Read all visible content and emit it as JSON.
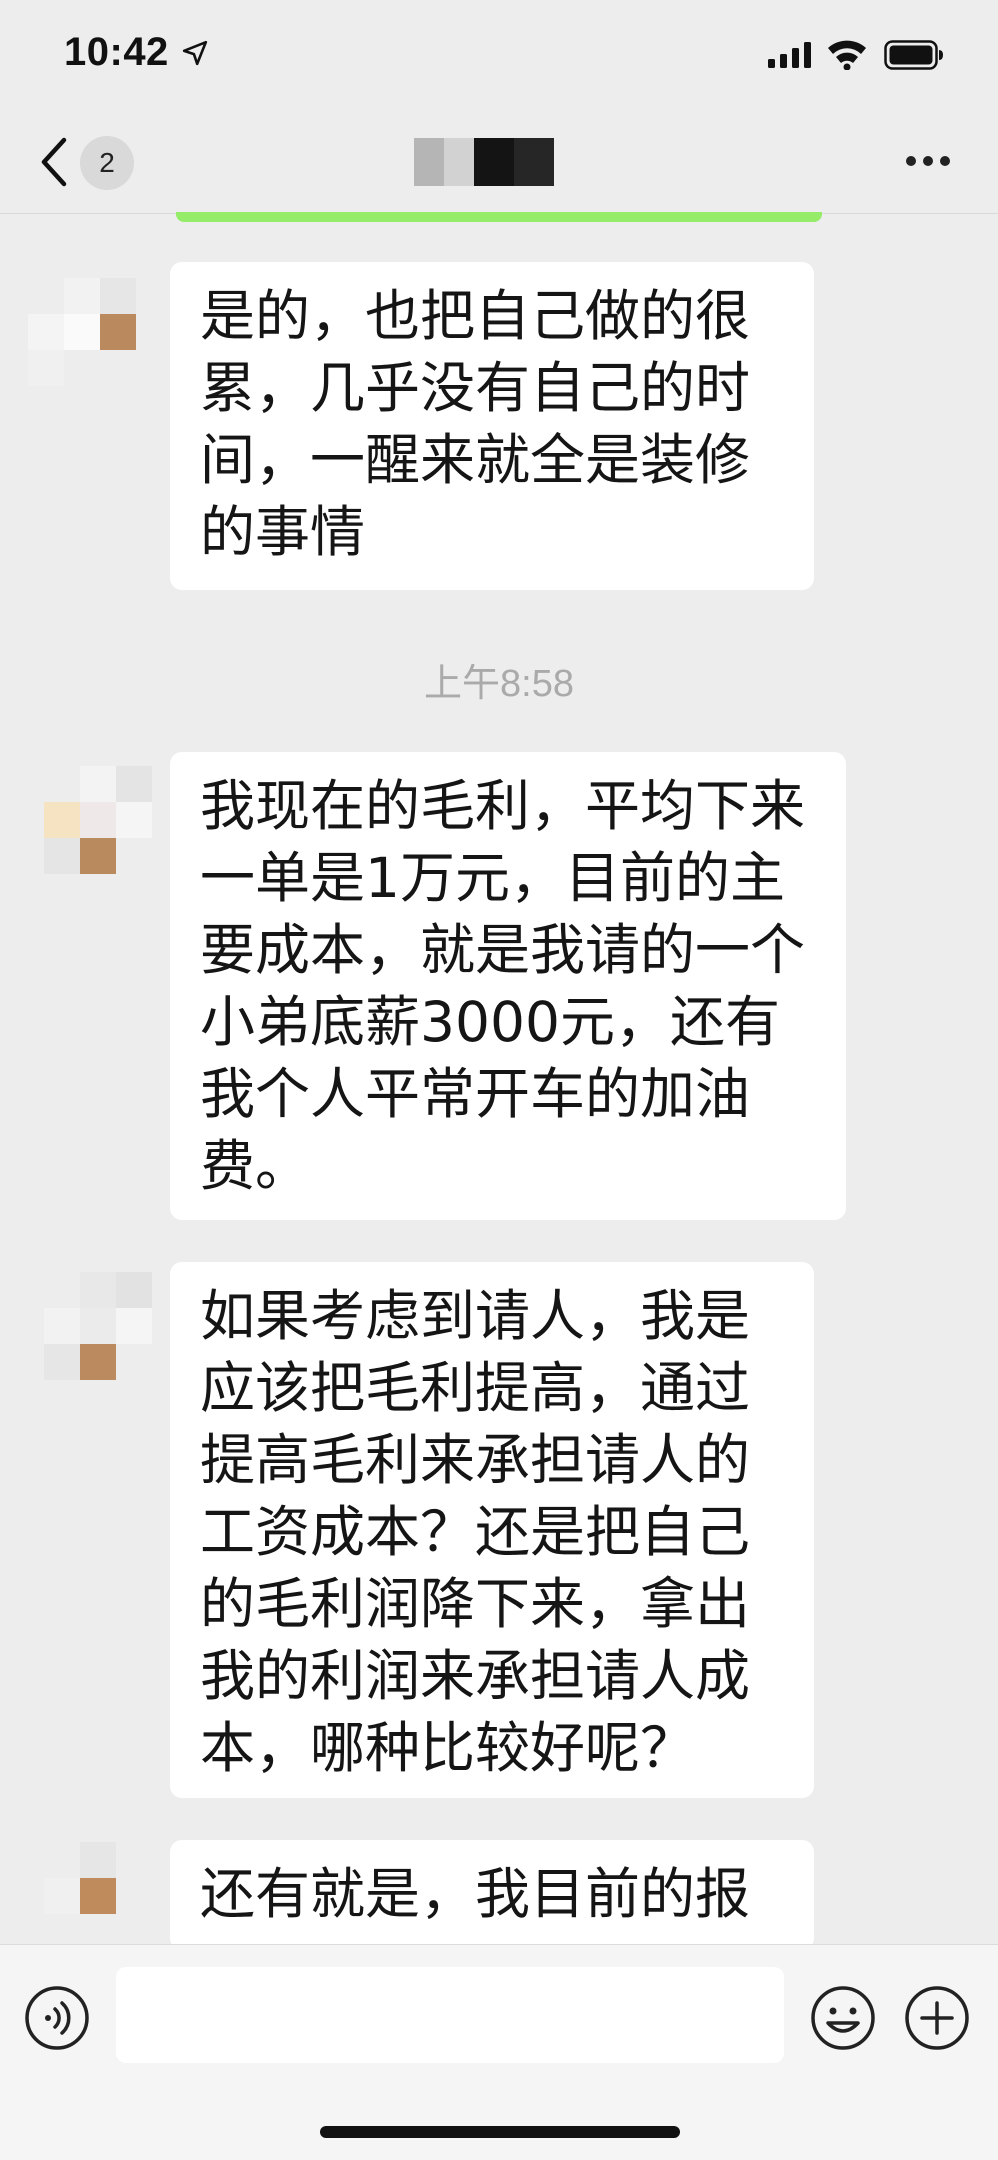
{
  "status_bar": {
    "time": "10:42"
  },
  "nav": {
    "unread_count": "2"
  },
  "messages": [
    {
      "text": "是的，也把自己做的很累，几乎没有自己的时间，一醒来就全是装修的事情"
    },
    {
      "text": "我现在的毛利，平均下来一单是1万元，目前的主要成本，就是我请的一个小弟底薪3000元，还有我个人平常开车的加油费。"
    },
    {
      "text": "如果考虑到请人，我是应该把毛利提高，通过提高毛利来承担请人的工资成本？还是把自己的毛利润降下来，拿出我的利润来承担请人成本，哪种比较好呢？"
    },
    {
      "text": "还有就是，我目前的报"
    }
  ],
  "timestamp": "上午8:58",
  "colors": {
    "background": "#ededed",
    "bubble": "#ffffff",
    "self_bubble": "#95ec69"
  },
  "icons": {
    "location": "location-arrow-icon",
    "signal": "cellular-signal-icon",
    "wifi": "wifi-icon",
    "battery": "battery-icon",
    "back": "chevron-left-icon",
    "more": "more-dots-icon",
    "voice": "voice-icon",
    "emoji": "emoji-icon",
    "plus": "plus-icon"
  }
}
